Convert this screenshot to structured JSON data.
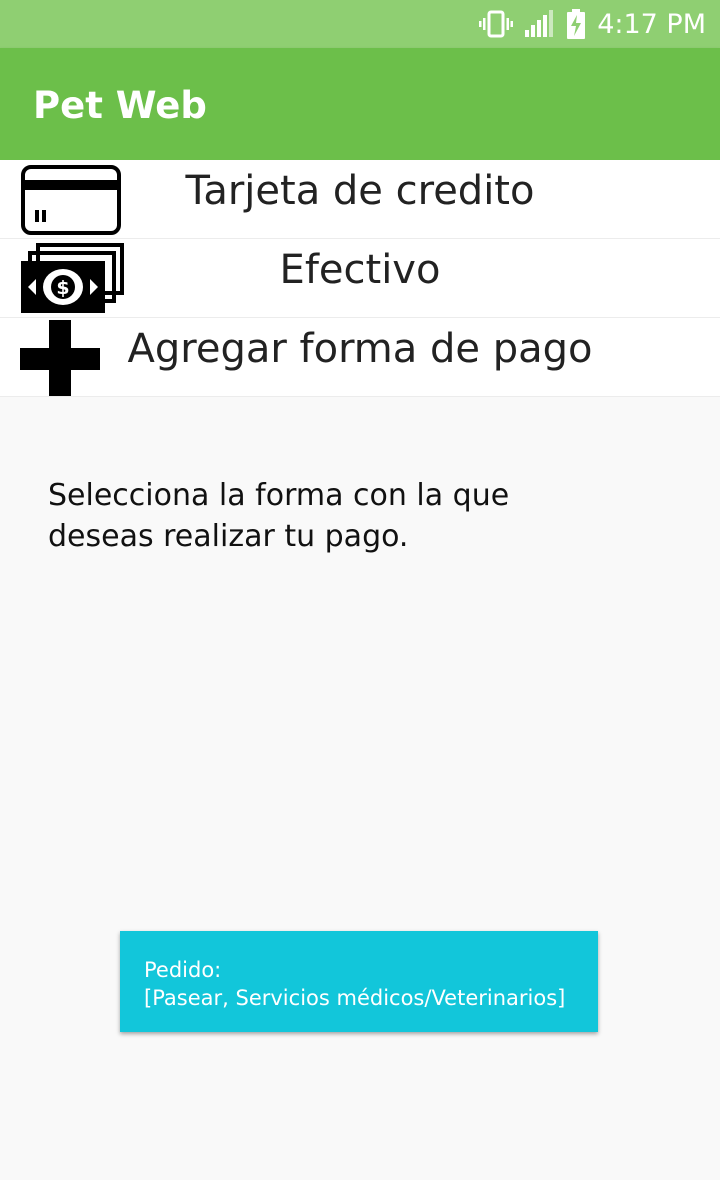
{
  "status_bar": {
    "time": "4:17 PM",
    "icons": [
      "vibrate-icon",
      "signal-icon",
      "battery-charging-icon"
    ]
  },
  "app_bar": {
    "title": "Pet Web",
    "color": "#6cbf4a"
  },
  "payment_methods": [
    {
      "label": "Tarjeta de credito",
      "icon": "credit-card-icon"
    },
    {
      "label": "Efectivo",
      "icon": "cash-icon"
    },
    {
      "label": "Agregar forma de pago",
      "icon": "plus-icon"
    }
  ],
  "instruction": {
    "line1": "Selecciona la forma con la que",
    "line2": "deseas realizar tu pago."
  },
  "order": {
    "heading": "Pedido:",
    "items": "[Pasear, Servicios médicos/Veterinarios]",
    "color": "#12c6da"
  }
}
